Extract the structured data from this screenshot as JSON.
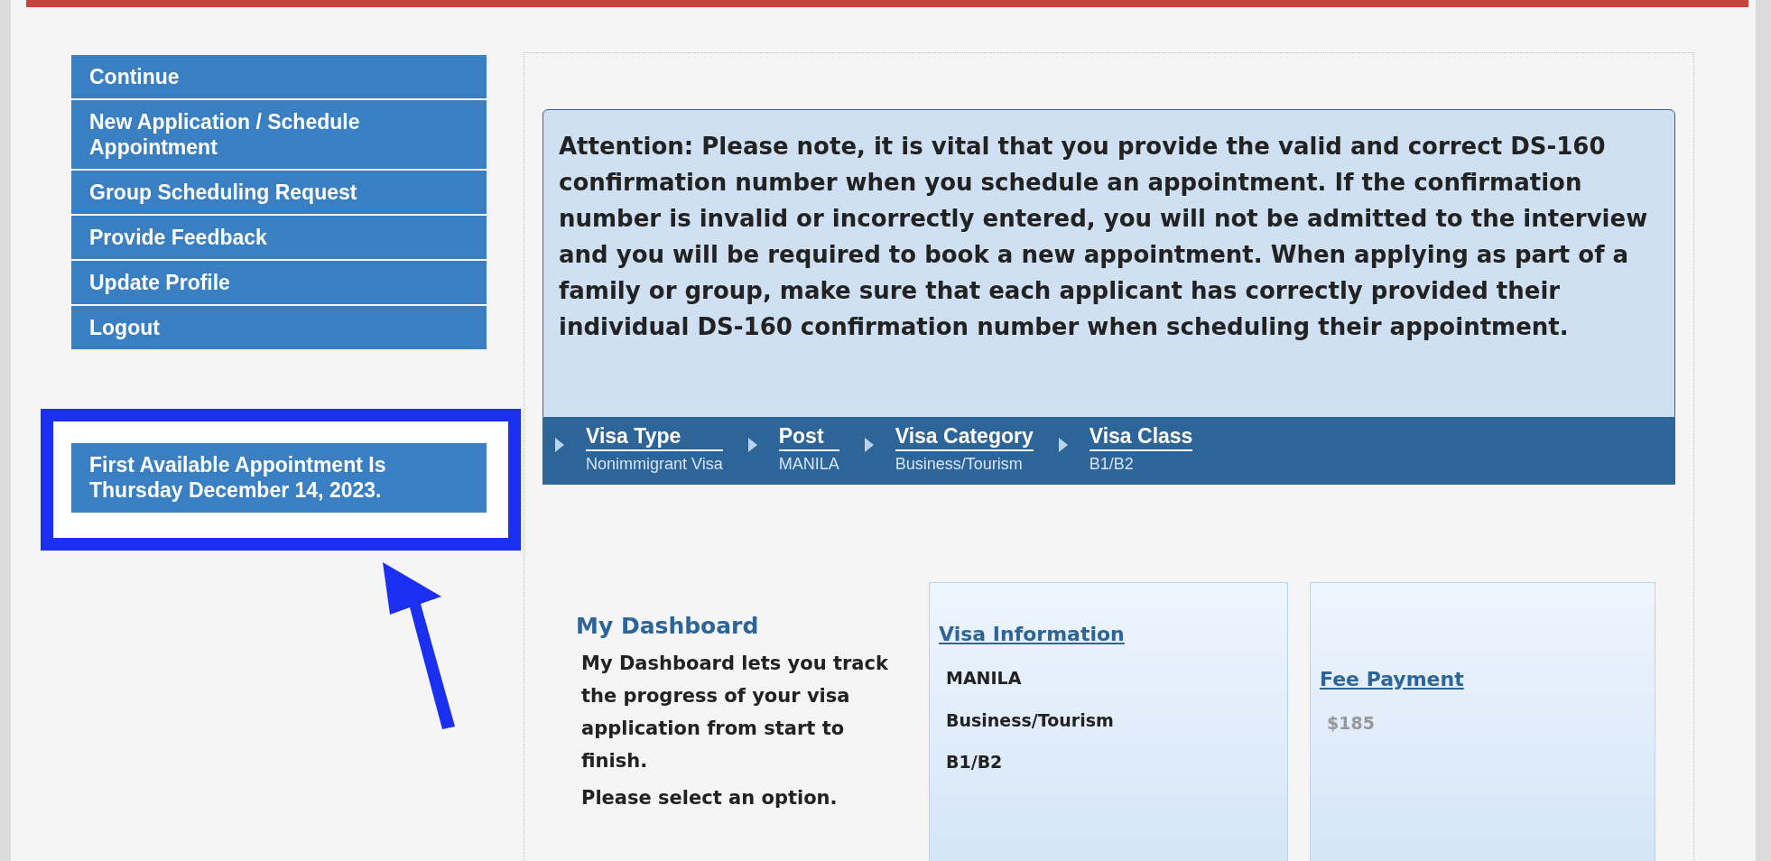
{
  "menu": [
    {
      "label": "Continue"
    },
    {
      "label": "New Application / Schedule Appointment"
    },
    {
      "label": "Group Scheduling Request"
    },
    {
      "label": "Provide Feedback"
    },
    {
      "label": "Update Profile"
    },
    {
      "label": "Logout"
    }
  ],
  "first_available": "First Available Appointment Is Thursday December 14, 2023.",
  "attention": "Attention: Please note, it is vital that you provide the valid and correct DS-160 confirmation number when you schedule an appointment. If the confirmation number is invalid or incorrectly entered, you will not be admitted to the interview and you will be required to book a new appointment. When applying as part of a family or group, make sure that each applicant has correctly provided their individual DS-160 confirmation number when scheduling their appointment.",
  "breadcrumb": [
    {
      "label": "Visa Type",
      "value": "Nonimmigrant Visa"
    },
    {
      "label": "Post",
      "value": "MANILA"
    },
    {
      "label": "Visa Category",
      "value": "Business/Tourism"
    },
    {
      "label": "Visa Class",
      "value": "B1/B2"
    }
  ],
  "dashboard": {
    "title": "My Dashboard",
    "description": "My Dashboard lets you track the progress of your visa application from start to finish.",
    "prompt": "Please select an option."
  },
  "cards": [
    {
      "title": "Visa Information",
      "lines": [
        "MANILA",
        "Business/Tourism",
        "B1/B2"
      ],
      "muted": false
    },
    {
      "title": "Fee Payment",
      "lines": [
        "$185"
      ],
      "muted": true
    }
  ]
}
